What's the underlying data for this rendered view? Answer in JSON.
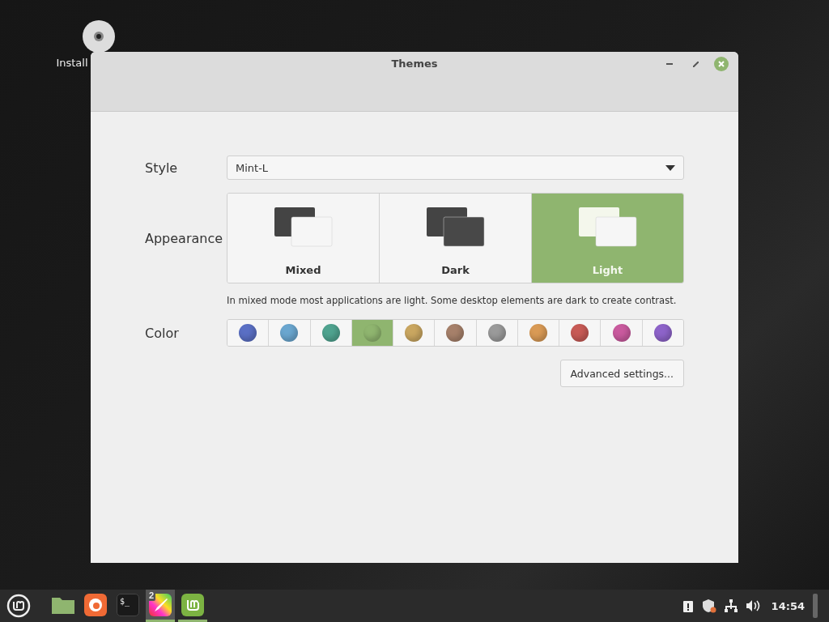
{
  "desktop": {
    "icons": [
      {
        "label": "Install"
      }
    ]
  },
  "window": {
    "title": "Themes",
    "controls": [
      {
        "kind": "minimize"
      },
      {
        "kind": "maximize"
      },
      {
        "kind": "close"
      }
    ]
  },
  "style": {
    "label": "Style",
    "value": "Mint-L"
  },
  "appearance": {
    "label": "Appearance",
    "options": [
      {
        "label": "Mixed",
        "kind": "mixed",
        "selected": false
      },
      {
        "label": "Dark",
        "kind": "dark",
        "selected": false
      },
      {
        "label": "Light",
        "kind": "light",
        "selected": true
      }
    ],
    "description": "In mixed mode most applications are light. Some desktop elements are dark to create contrast."
  },
  "color": {
    "label": "Color",
    "swatches": [
      {
        "color": "#5a6fc4",
        "selected": false
      },
      {
        "color": "#6aa6cf",
        "selected": false
      },
      {
        "color": "#4fa38f",
        "selected": false
      },
      {
        "color": "#8fb56f",
        "selected": true
      },
      {
        "color": "#c9a660",
        "selected": false
      },
      {
        "color": "#a6806a",
        "selected": false
      },
      {
        "color": "#9a9a9a",
        "selected": false
      },
      {
        "color": "#d99a55",
        "selected": false
      },
      {
        "color": "#c75a55",
        "selected": false
      },
      {
        "color": "#c95a9e",
        "selected": false
      },
      {
        "color": "#8d63c9",
        "selected": false
      }
    ]
  },
  "advanced_button": "Advanced settings...",
  "taskbar": {
    "apps": [
      {
        "kind": "files",
        "active": false,
        "running": false
      },
      {
        "kind": "browser",
        "active": false,
        "running": false
      },
      {
        "kind": "terminal",
        "label": "$_",
        "active": false,
        "running": false
      },
      {
        "kind": "paint",
        "badge": "2",
        "active": true,
        "running": true
      },
      {
        "kind": "mint",
        "active": false,
        "running": true
      }
    ],
    "clock": "14:54"
  }
}
